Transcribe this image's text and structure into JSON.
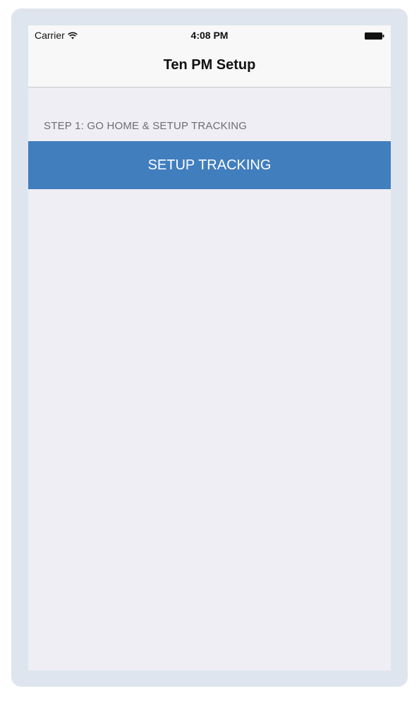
{
  "status_bar": {
    "carrier": "Carrier",
    "time": "4:08 PM",
    "wifi_icon": "wifi-icon",
    "battery_icon": "battery-icon"
  },
  "nav": {
    "title": "Ten PM Setup"
  },
  "step1": {
    "header": "STEP 1: GO HOME & SETUP TRACKING",
    "button_label": "SETUP TRACKING"
  },
  "colors": {
    "accent": "#417ebe",
    "background": "#efeef4",
    "frame": "#dfe5ee",
    "bar": "#f8f8f8"
  }
}
